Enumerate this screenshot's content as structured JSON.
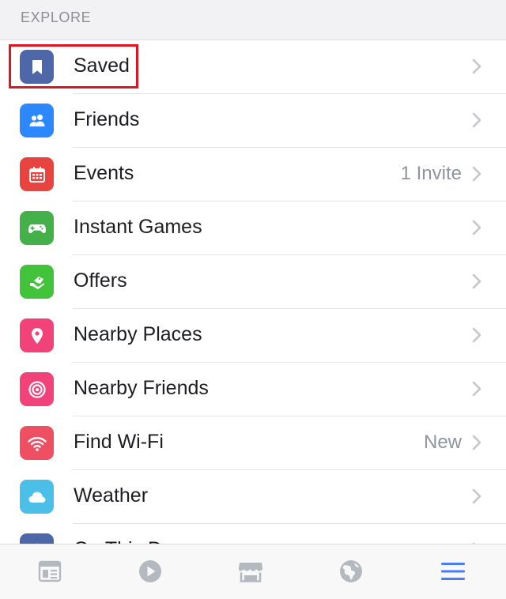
{
  "section": {
    "title": "EXPLORE"
  },
  "colors": {
    "accent": "#4a7cff",
    "tab_inactive": "#b4b8bf",
    "highlight": "#e0151f"
  },
  "items": [
    {
      "label": "Saved",
      "detail": "",
      "icon": "bookmark-icon",
      "color": "#4e67a8"
    },
    {
      "label": "Friends",
      "detail": "",
      "icon": "friends-icon",
      "color": "#2d88ff"
    },
    {
      "label": "Events",
      "detail": "1 Invite",
      "icon": "calendar-icon",
      "color": "#e9433f"
    },
    {
      "label": "Instant Games",
      "detail": "",
      "icon": "gamepad-icon",
      "color": "#44b04a"
    },
    {
      "label": "Offers",
      "detail": "",
      "icon": "offer-icon",
      "color": "#43c33c"
    },
    {
      "label": "Nearby Places",
      "detail": "",
      "icon": "location-pin-icon",
      "color": "#f2427a"
    },
    {
      "label": "Nearby Friends",
      "detail": "",
      "icon": "target-icon",
      "color": "#f2427a"
    },
    {
      "label": "Find Wi-Fi",
      "detail": "New",
      "icon": "wifi-icon",
      "color": "#ee4f63"
    },
    {
      "label": "Weather",
      "detail": "",
      "icon": "cloud-icon",
      "color": "#4bbfe8"
    },
    {
      "label": "On This D",
      "detail": "",
      "icon": "clock-icon",
      "color": "#4e67a8"
    }
  ],
  "tabs": [
    {
      "name": "news-feed-tab",
      "icon": "news-feed-icon",
      "active": false
    },
    {
      "name": "watch-tab",
      "icon": "play-icon",
      "active": false
    },
    {
      "name": "marketplace-tab",
      "icon": "storefront-icon",
      "active": false
    },
    {
      "name": "notifications-tab",
      "icon": "globe-icon",
      "active": false
    },
    {
      "name": "menu-tab",
      "icon": "menu-icon",
      "active": true
    }
  ]
}
